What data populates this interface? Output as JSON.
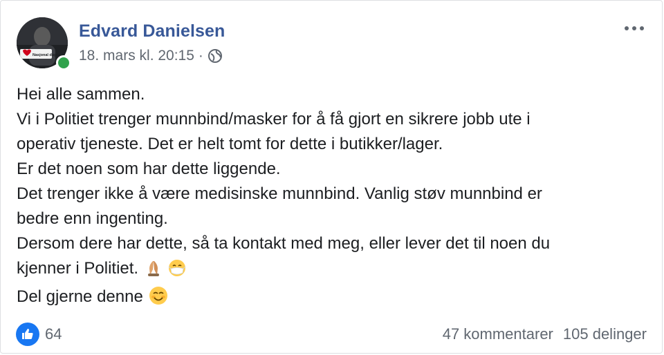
{
  "post": {
    "author": "Edvard Danielsen",
    "timestamp": "18. mars kl. 20:15",
    "separator": "·",
    "avatar_badge": "Nasjonal dugnad",
    "body_lines": [
      "Hei alle sammen.",
      "Vi i Politiet trenger munnbind/masker for å få gjort en sikrere jobb ute i",
      "operativ tjeneste. Det er helt tomt for dette i butikker/lager.",
      "Er det noen som har dette liggende.",
      "Det trenger ikke å være medisinske munnbind. Vanlig støv munnbind er",
      "bedre enn ingenting.",
      "Dersom dere har dette, så ta kontakt med meg, eller lever det til noen du",
      "kjenner i Politiet.",
      "Del gjerne denne"
    ],
    "line8_emojis": [
      "folded-hands-emoji",
      "mask-face-emoji"
    ],
    "line9_emojis": [
      "smiling-face-emoji"
    ]
  },
  "footer": {
    "like_count": "64",
    "comments": "47 kommentarer",
    "shares": "105 delinger"
  },
  "colors": {
    "author": "#385898",
    "meta": "#606770",
    "like_blue": "#1877f2",
    "online_green": "#31a24c"
  }
}
